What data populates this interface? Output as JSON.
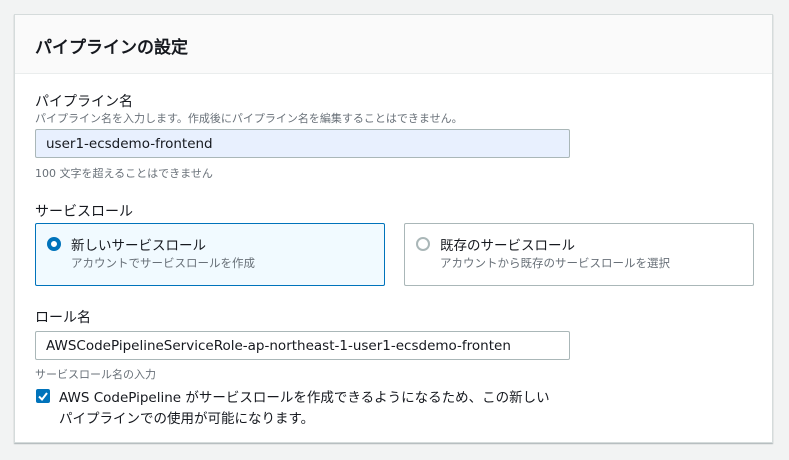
{
  "section": {
    "title": "パイプラインの設定"
  },
  "pipeline_name": {
    "label": "パイプライン名",
    "description": "パイプライン名を入力します。作成後にパイプライン名を編集することはできません。",
    "value": "user1-ecsdemo-frontend",
    "constraint": "100 文字を超えることはできません"
  },
  "service_role": {
    "label": "サービスロール",
    "options": [
      {
        "title": "新しいサービスロール",
        "subtitle": "アカウントでサービスロールを作成",
        "selected": true
      },
      {
        "title": "既存のサービスロール",
        "subtitle": "アカウントから既存のサービスロールを選択",
        "selected": false
      }
    ]
  },
  "role_name": {
    "label": "ロール名",
    "value": "AWSCodePipelineServiceRole-ap-northeast-1-user1-ecsdemo-fronten",
    "hint": "サービスロール名の入力"
  },
  "allow_checkbox": {
    "checked": true,
    "line1": "AWS CodePipeline がサービスロールを作成できるようになるため、この新しい",
    "line2": "パイプラインでの使用が可能になります。"
  },
  "colors": {
    "accent": "#0073bb",
    "filled_input": "#e8f0fe",
    "selected_tile": "#f1faff"
  }
}
